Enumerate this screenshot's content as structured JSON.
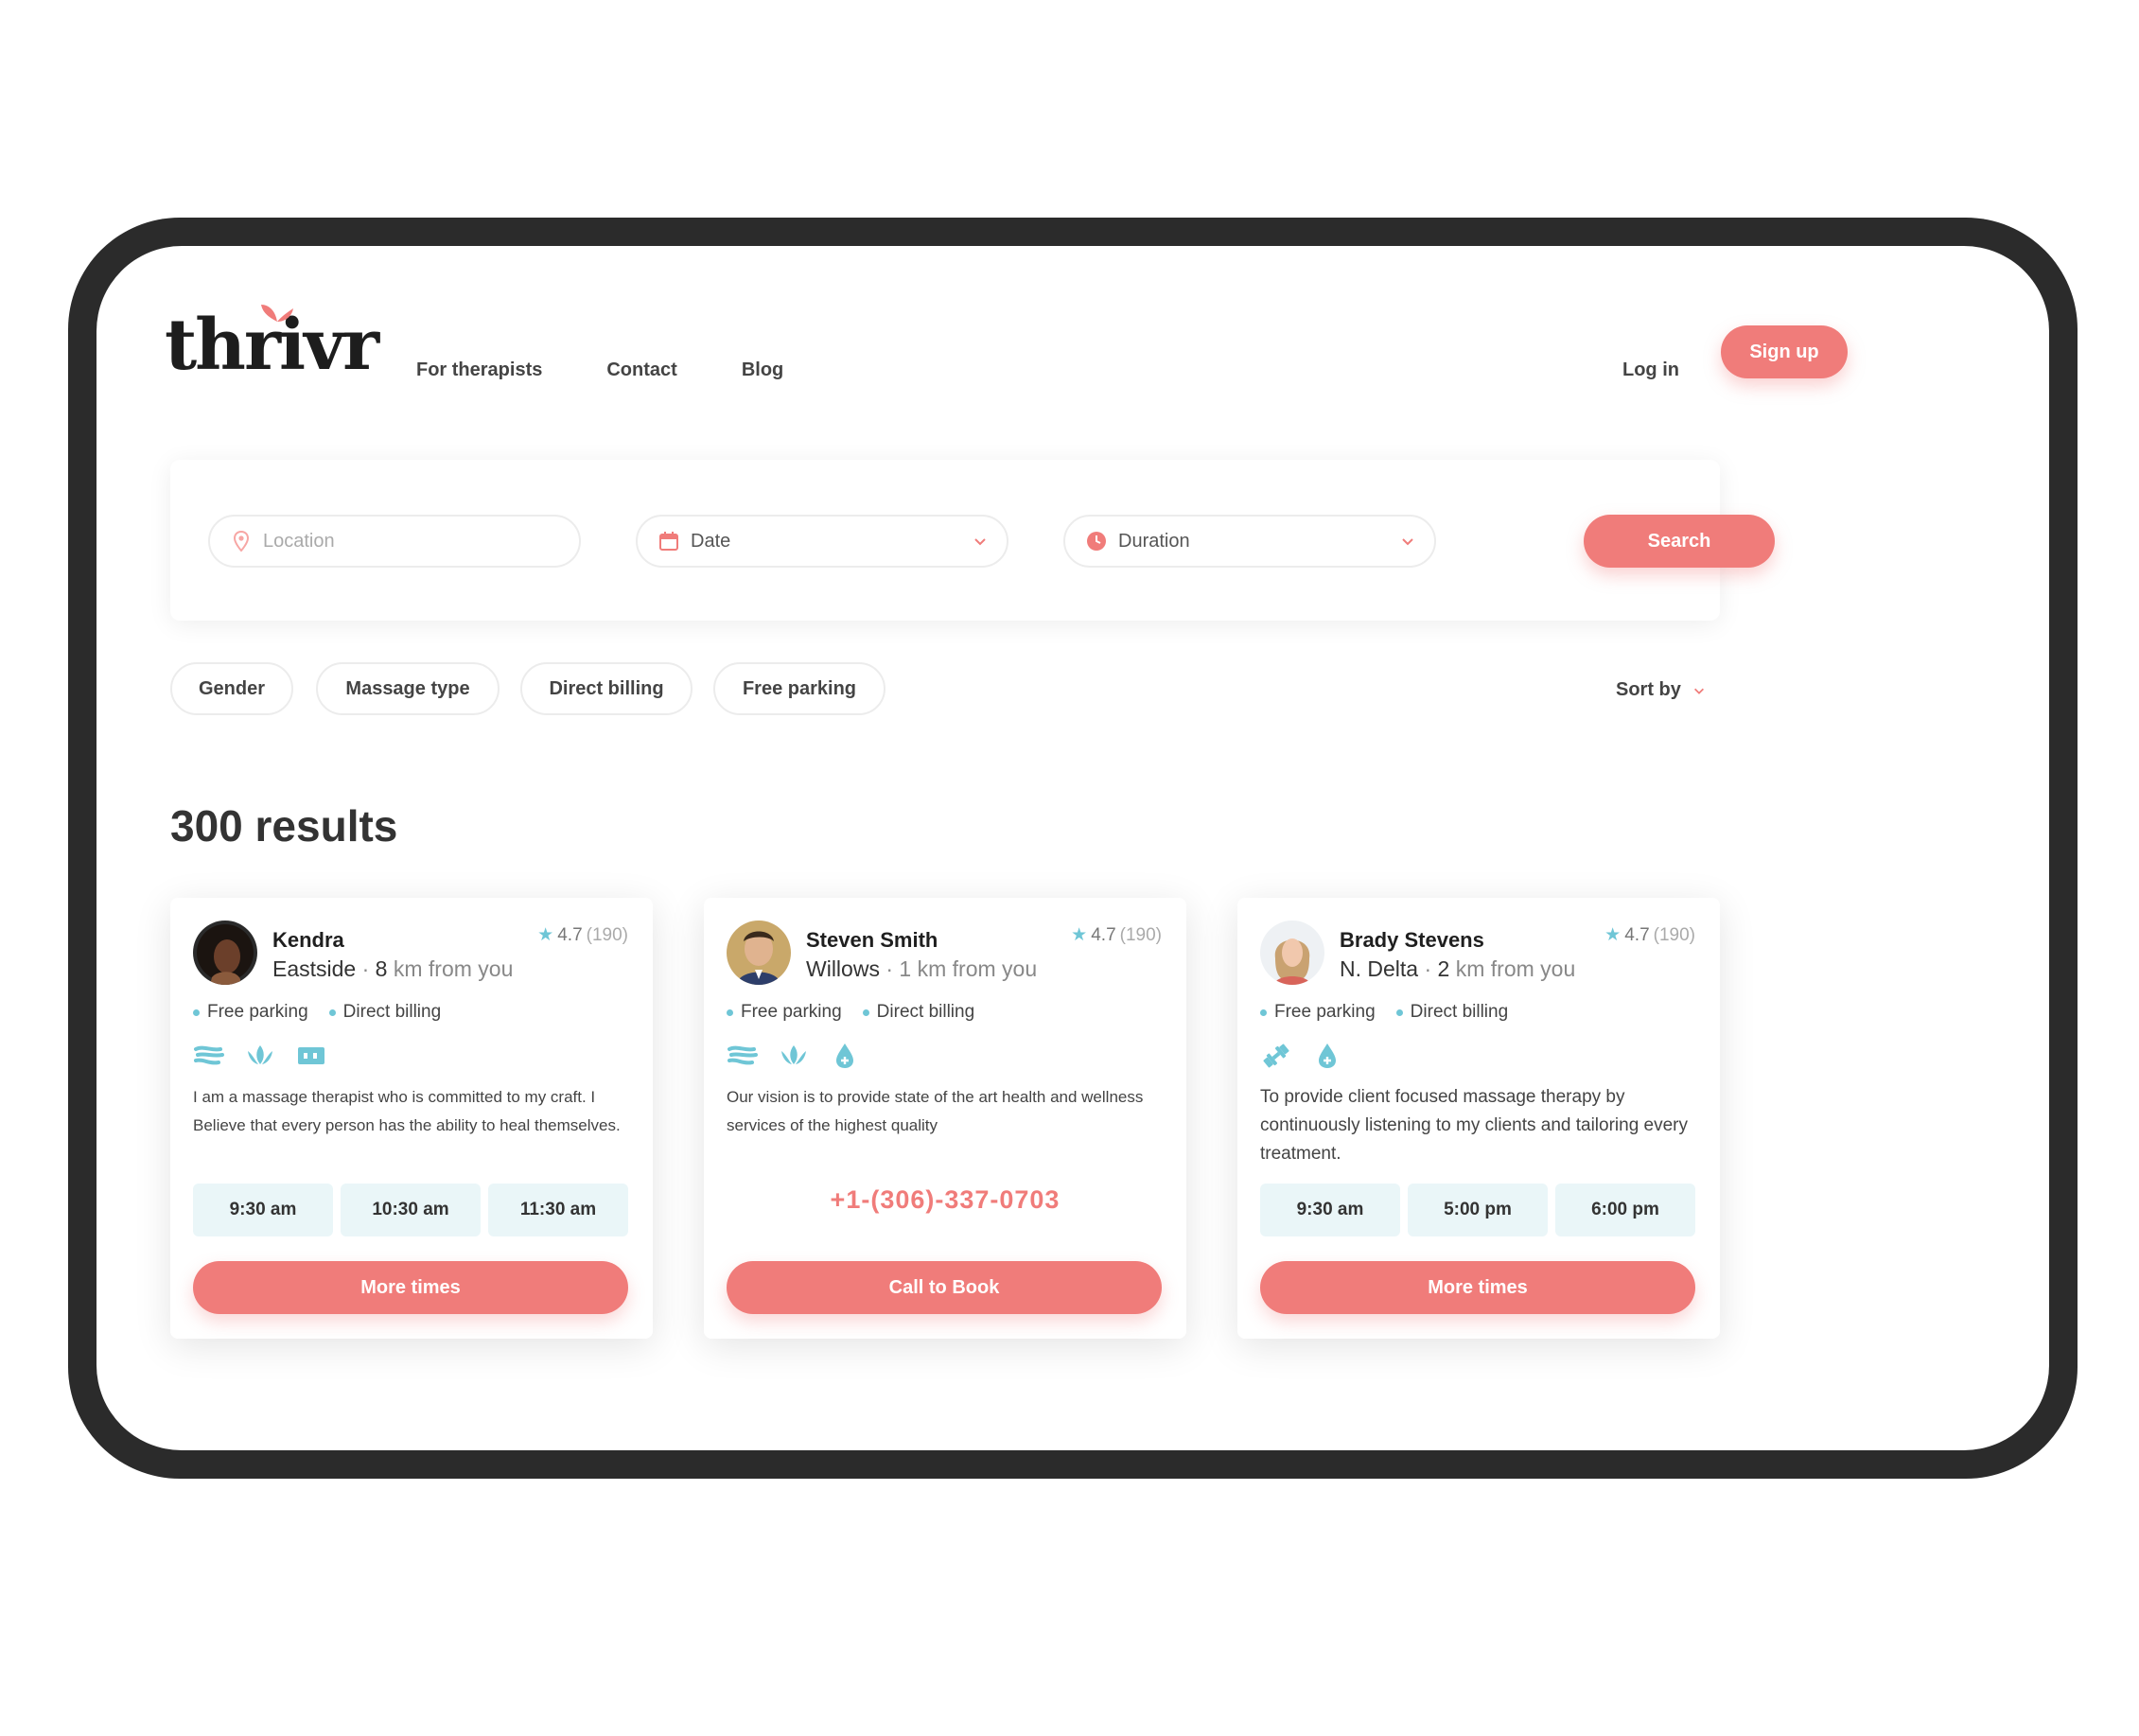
{
  "brand": {
    "name": "thrivr",
    "accent": "#f07c7a",
    "teal": "#6fc6d6"
  },
  "nav": {
    "items": [
      "For therapists",
      "Contact",
      "Blog"
    ]
  },
  "auth": {
    "login": "Log in",
    "signup": "Sign up"
  },
  "search": {
    "location_placeholder": "Location",
    "date_label": "Date",
    "duration_label": "Duration",
    "button": "Search"
  },
  "filters": {
    "chips": [
      "Gender",
      "Massage type",
      "Direct billing",
      "Free parking"
    ],
    "sort_label": "Sort by"
  },
  "results": {
    "count_text": "300 results"
  },
  "cards": [
    {
      "name": "Kendra",
      "area": "Eastside",
      "distance_num": "8",
      "distance_unit": "km from you",
      "rating": "4.7",
      "reviews": "(190)",
      "tags": [
        "Free parking",
        "Direct billing"
      ],
      "icons": [
        "hands-massage-icon",
        "lotus-icon",
        "card-billing-icon"
      ],
      "description": "I am a massage therapist who is committed to  my craft. I Believe that every person has the ability to heal themselves.",
      "slots": [
        "9:30 am",
        "10:30 am",
        "11:30 am"
      ],
      "cta": "More times"
    },
    {
      "name": "Steven Smith",
      "area": "Willows",
      "distance_num": "1",
      "distance_unit": "km from you",
      "rating": "4.7",
      "reviews": "(190)",
      "tags": [
        "Free parking",
        "Direct billing"
      ],
      "icons": [
        "hands-massage-icon",
        "lotus-icon",
        "oil-drop-icon"
      ],
      "description": "Our vision is to provide state of the art health and wellness services of the highest quality",
      "phone": "+1-(306)-337-0703",
      "cta": "Call to Book"
    },
    {
      "name": "Brady Stevens",
      "area": "N. Delta",
      "distance_num": "2",
      "distance_unit": "km from you",
      "rating": "4.7",
      "reviews": "(190)",
      "tags": [
        "Free parking",
        "Direct billing"
      ],
      "icons": [
        "dumbbell-icon",
        "oil-drop-icon"
      ],
      "description": "To provide client focused massage therapy by continuously listening to my clients and tailoring every treatment.",
      "slots": [
        "9:30 am",
        "5:00 pm",
        "6:00 pm"
      ],
      "cta": "More times"
    }
  ]
}
